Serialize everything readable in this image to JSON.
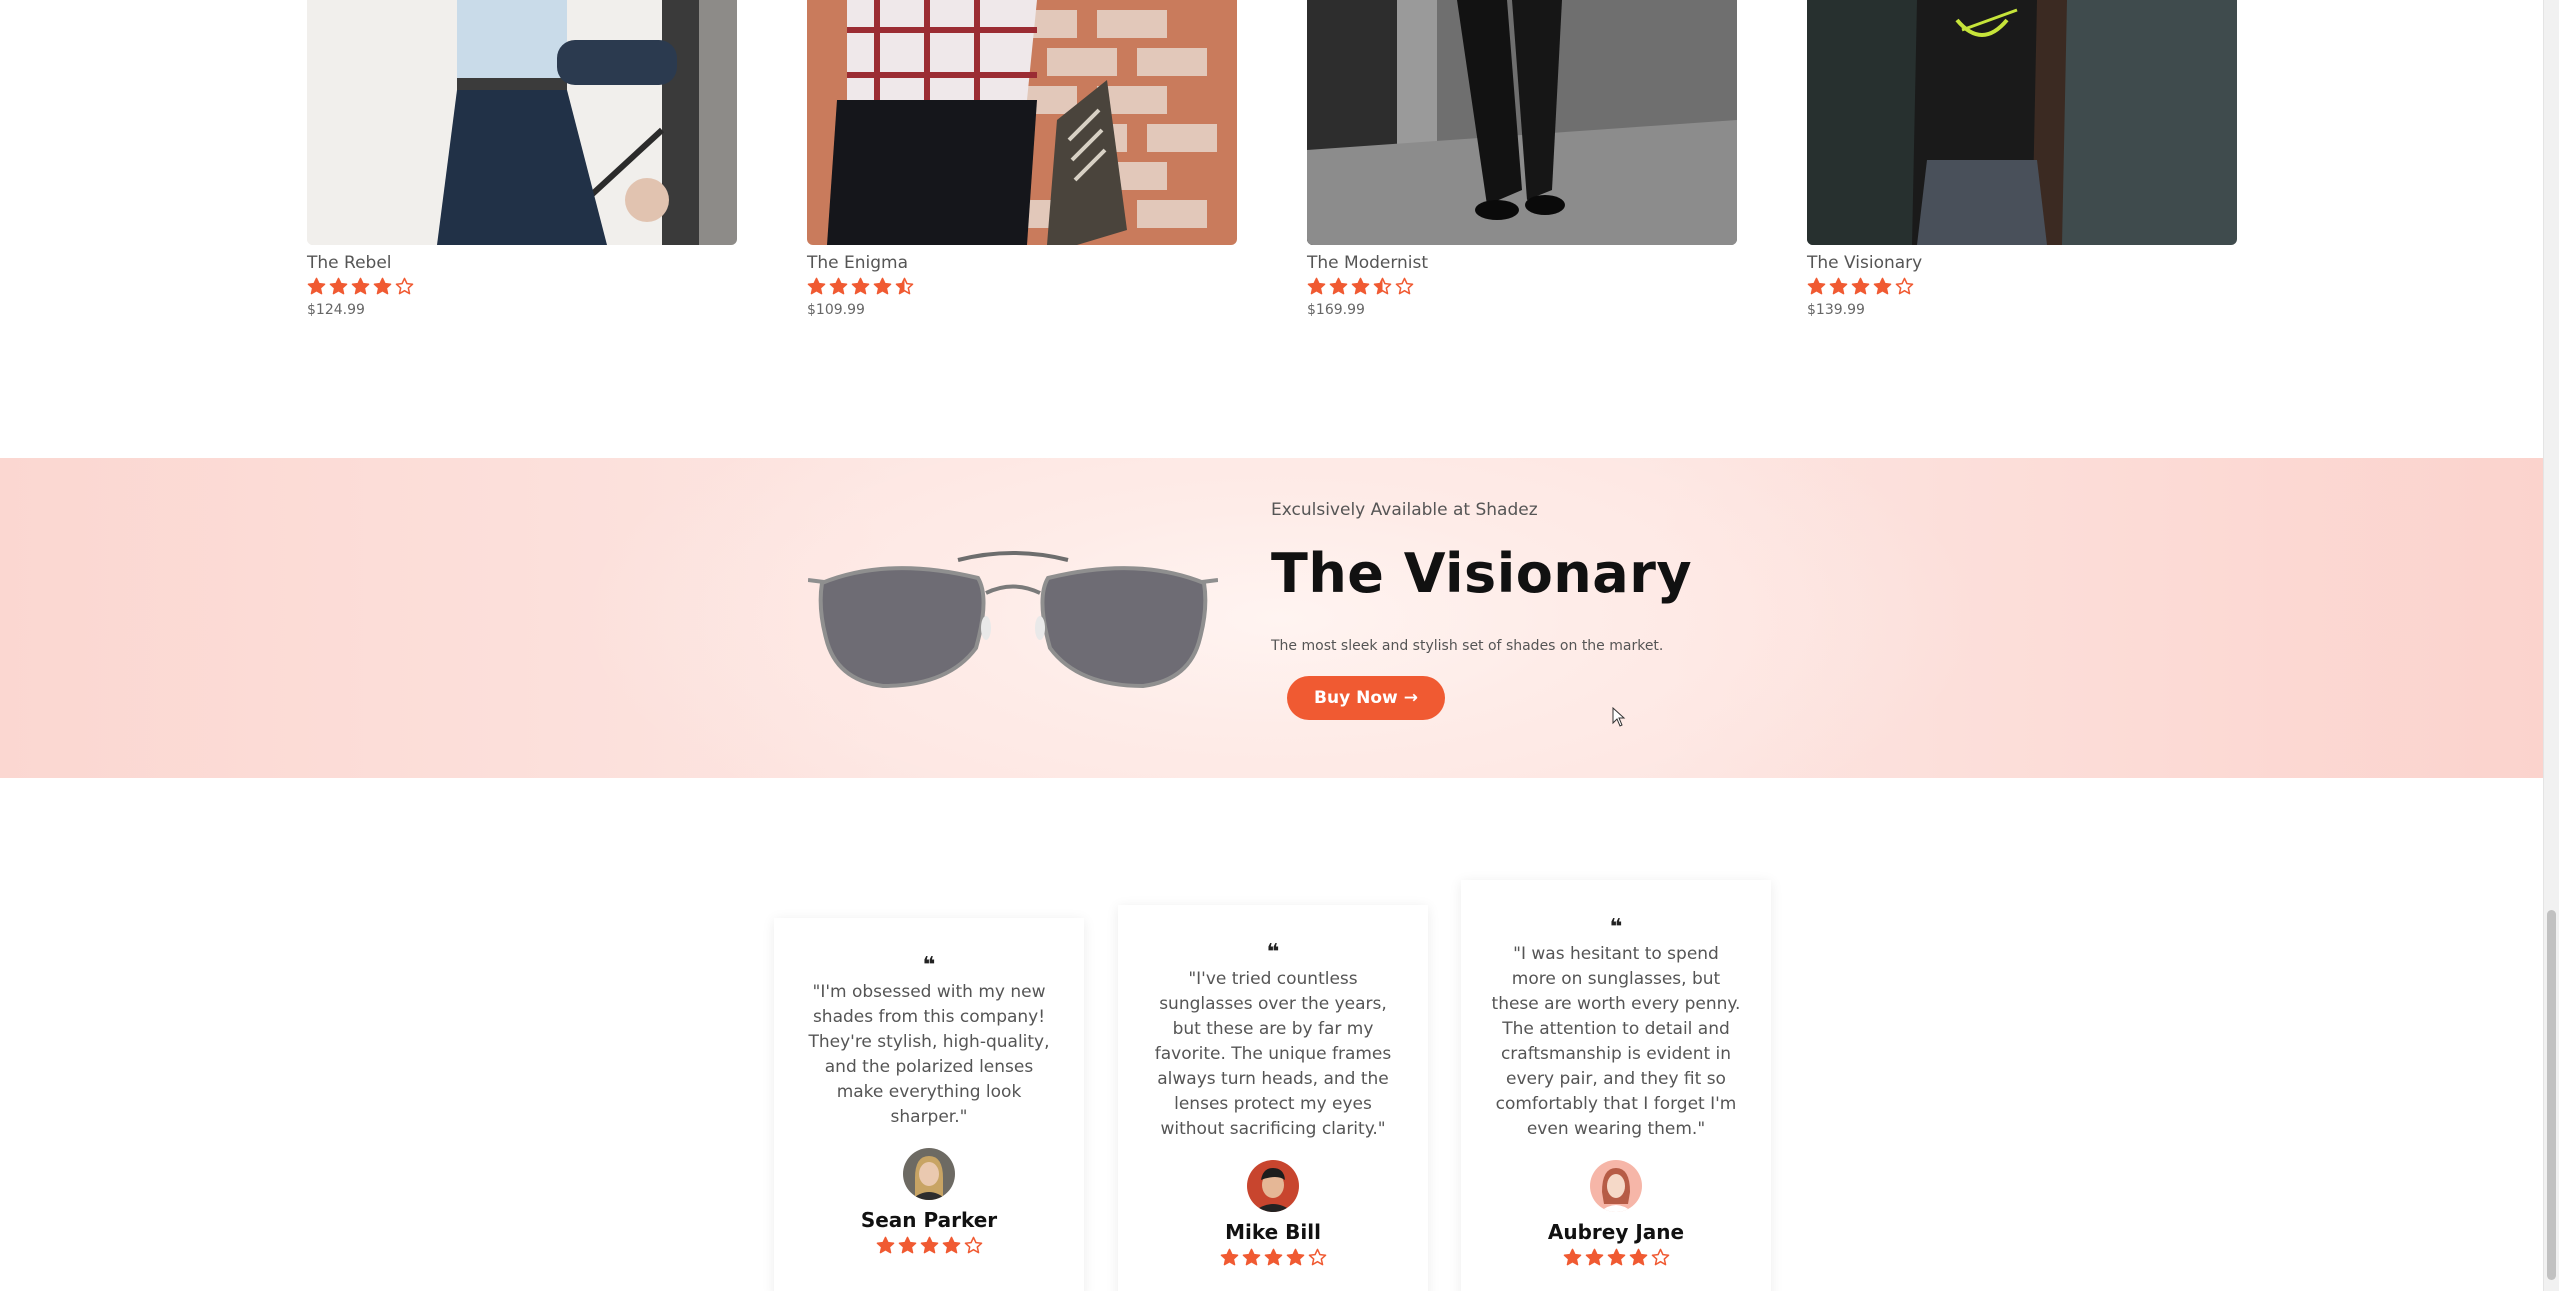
{
  "products": [
    {
      "name": "The Rebel",
      "price": "$124.99",
      "rating": 4
    },
    {
      "name": "The Enigma",
      "price": "$109.99",
      "rating": 4.5
    },
    {
      "name": "The Modernist",
      "price": "$169.99",
      "rating": 3.5
    },
    {
      "name": "The Visionary",
      "price": "$139.99",
      "rating": 4
    }
  ],
  "promo": {
    "kicker": "Exculsively Available at Shadez",
    "title": "The Visionary",
    "subtitle": "The most sleek and stylish set of shades on the market.",
    "button_label": "Buy Now",
    "button_arrow": "→"
  },
  "testimonials": [
    {
      "quote_mark": "❝",
      "text": "\"I'm obsessed with my new shades from this company! They're stylish, high-quality, and the polarized lenses make everything look sharper.\"",
      "author": "Sean Parker",
      "rating": 4
    },
    {
      "quote_mark": "❝",
      "text": "\"I've tried countless sunglasses over the years, but these are by far my favorite. The unique frames always turn heads, and the lenses protect my eyes without sacrificing clarity.\"",
      "author": "Mike Bill",
      "rating": 4
    },
    {
      "quote_mark": "❝",
      "text": "\"I was hesitant to spend more on sunglasses, but these are worth every penny. The attention to detail and craftsmanship is evident in every pair, and they fit so comfortably that I forget I'm even wearing them.\"",
      "author": "Aubrey Jane",
      "rating": 4
    }
  ],
  "colors": {
    "accent": "#f05a32",
    "star": "#f05a32",
    "promo_bg": "#fde1dc"
  },
  "icons": {
    "star": "star-icon",
    "cursor": "mouse-cursor-icon",
    "quote": "quote-icon"
  }
}
